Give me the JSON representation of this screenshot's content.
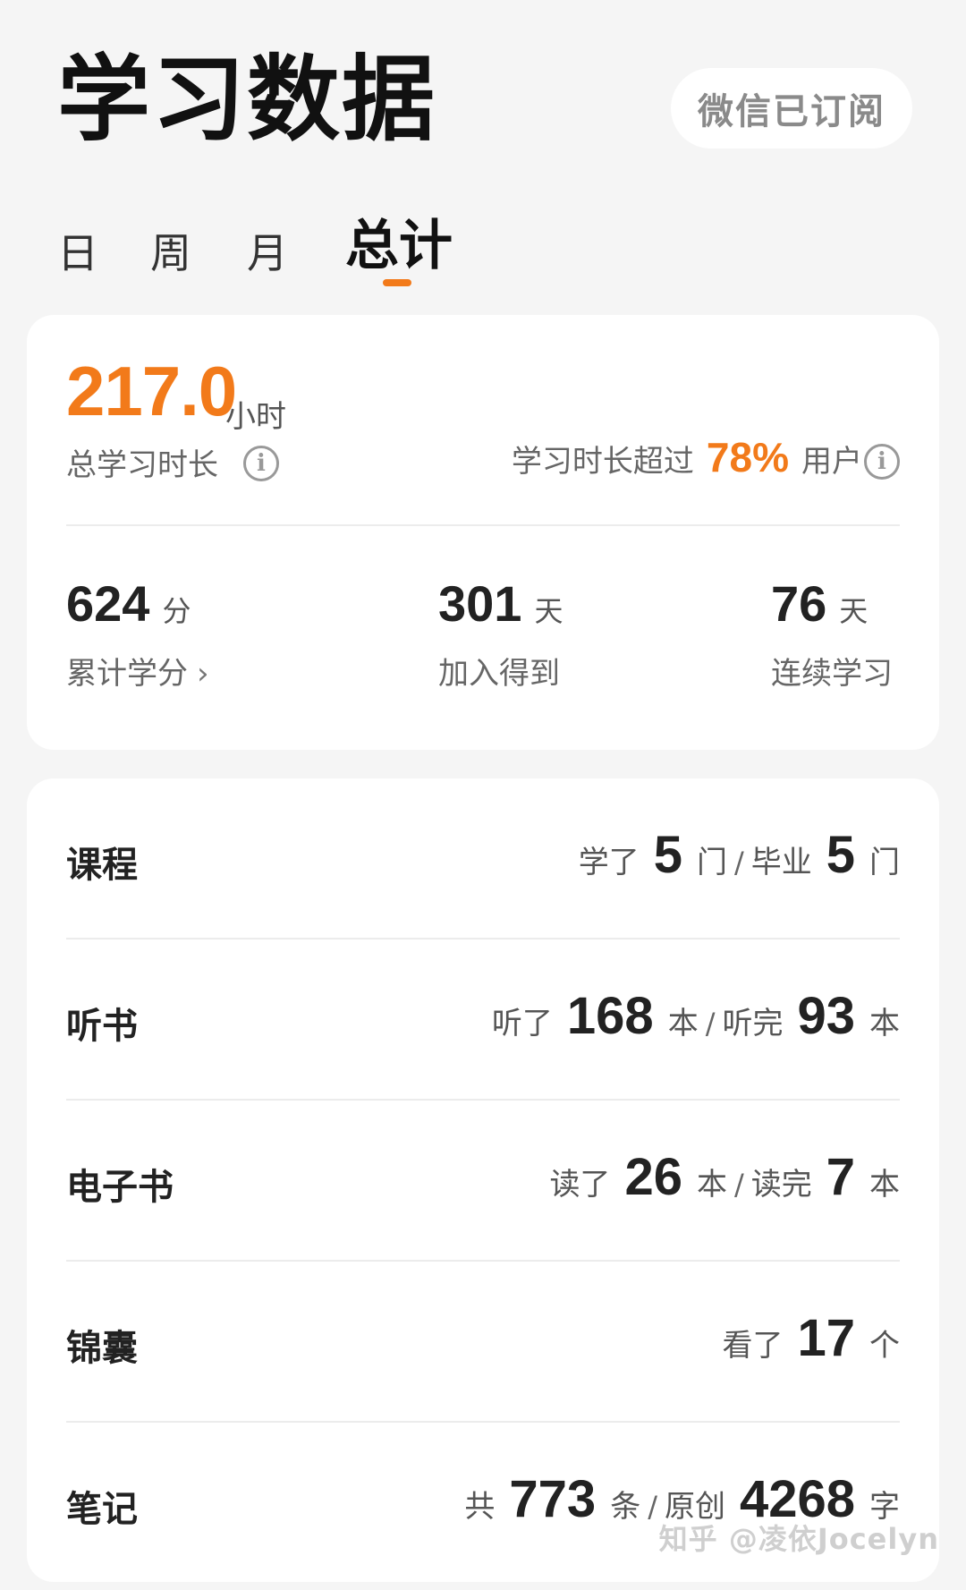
{
  "header": {
    "title": "学习数据",
    "subscribe_button": "微信已订阅"
  },
  "tabs": [
    {
      "label": "日",
      "active": false
    },
    {
      "label": "周",
      "active": false
    },
    {
      "label": "月",
      "active": false
    },
    {
      "label": "总计",
      "active": true
    }
  ],
  "summary": {
    "total_hours": "217.0",
    "hours_unit": "小时",
    "total_label": "总学习时长",
    "percentile_prefix": "学习时长超过",
    "percentile_value": "78%",
    "percentile_suffix": "用户",
    "info_icon": "i",
    "stats": [
      {
        "value": "624",
        "unit": "分",
        "label": "累计学分",
        "chevron": "›"
      },
      {
        "value": "301",
        "unit": "天",
        "label": "加入得到"
      },
      {
        "value": "76",
        "unit": "天",
        "label": "连续学习"
      }
    ]
  },
  "details": [
    {
      "label": "课程",
      "segments": [
        "学了",
        "5",
        "门",
        "/",
        "毕业",
        "5",
        "门"
      ]
    },
    {
      "label": "听书",
      "segments": [
        "听了",
        "168",
        "本",
        "/",
        "听完",
        "93",
        "本"
      ]
    },
    {
      "label": "电子书",
      "segments": [
        "读了",
        "26",
        "本",
        "/",
        "读完",
        "7",
        "本"
      ]
    },
    {
      "label": "锦囊",
      "segments": [
        "看了",
        "17",
        "个"
      ]
    },
    {
      "label": "笔记",
      "segments": [
        "共",
        "773",
        "条",
        "/",
        "原创",
        "4268",
        "字"
      ]
    }
  ],
  "watermark": "知乎 @凌依Jocelyn",
  "colors": {
    "accent": "#f27a1a",
    "background": "#f5f5f5",
    "card": "#ffffff"
  }
}
